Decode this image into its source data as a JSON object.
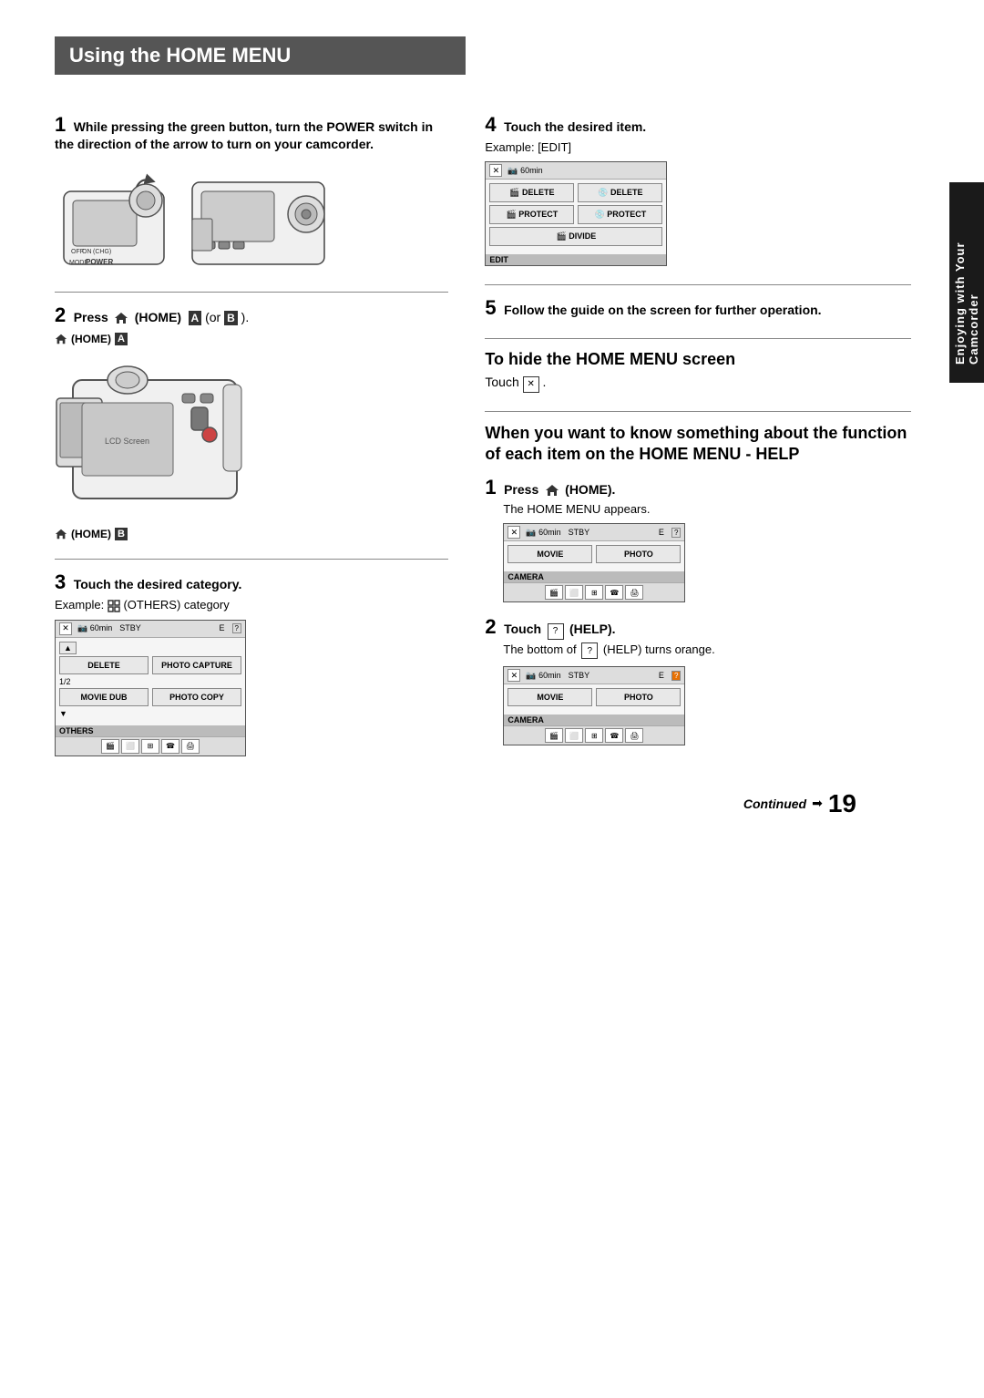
{
  "page": {
    "title": "Using the HOME MENU",
    "page_number": "19",
    "continued_label": "Continued",
    "side_tab_text": "Enjoying with Your Camcorder"
  },
  "left_col": {
    "step1": {
      "num": "1",
      "text": "While pressing the green button, turn the POWER switch in the direction of the arrow to turn on your camcorder."
    },
    "step2": {
      "num": "2",
      "text": "Press",
      "icon": "HOME",
      "suffix": "(HOME)",
      "ab_text": "A (or B).",
      "home_a_label": "(HOME)",
      "home_a_badge": "A",
      "home_b_label": "(HOME)",
      "home_b_badge": "B"
    },
    "step3": {
      "num": "3",
      "text": "Touch the desired category.",
      "example_text": "Example:",
      "example_icon": "grid",
      "example_suffix": "(OTHERS) category"
    }
  },
  "right_col": {
    "step4": {
      "num": "4",
      "text": "Touch the desired item.",
      "example_label": "Example: [EDIT]",
      "screen": {
        "battery": "60min",
        "buttons": [
          {
            "label": "DELETE",
            "icon": "film",
            "second": "DELETE",
            "second_icon": "disc"
          },
          {
            "label": "PROTECT",
            "icon": "film",
            "second": "PROTECT",
            "second_icon": "disc"
          },
          {
            "label": "DIVIDE",
            "icon": "film",
            "second": null
          }
        ],
        "bottom_label": "EDIT"
      }
    },
    "step5": {
      "num": "5",
      "text": "Follow the guide on the screen for further operation."
    },
    "hide_section": {
      "title": "To hide the HOME MENU screen",
      "text": "Touch",
      "icon_label": "X",
      "period": "."
    },
    "help_section": {
      "title": "When you want to know something about the function of each item on the HOME MENU - HELP",
      "step1": {
        "num": "1",
        "text": "Press",
        "icon": "HOME",
        "suffix": "(HOME).",
        "sub_text": "The HOME MENU appears.",
        "screen": {
          "battery": "60min",
          "stby": "STBY",
          "icon1": "E",
          "icon2": "?",
          "buttons": [
            "MOVIE",
            "PHOTO"
          ],
          "bottom_label": "CAMERA"
        }
      },
      "step2": {
        "num": "2",
        "text": "Touch",
        "icon_label": "?",
        "suffix": "(HELP).",
        "sub_text": "The bottom of",
        "sub_icon": "?",
        "sub_suffix": "(HELP) turns orange.",
        "screen": {
          "battery": "60min",
          "stby": "STBY",
          "icon1": "E",
          "icon2": "?",
          "buttons": [
            "MOVIE",
            "PHOTO"
          ],
          "bottom_label": "CAMERA"
        }
      }
    }
  },
  "others_screen": {
    "battery": "60min",
    "stby": "STBY",
    "icon1": "E",
    "icon2": "?",
    "row1": [
      "DELETE",
      "PHOTO CAPTURE"
    ],
    "page_label": "1/2",
    "row2": [
      "MOVIE DUB",
      "PHOTO COPY"
    ],
    "bottom_label": "OTHERS"
  }
}
